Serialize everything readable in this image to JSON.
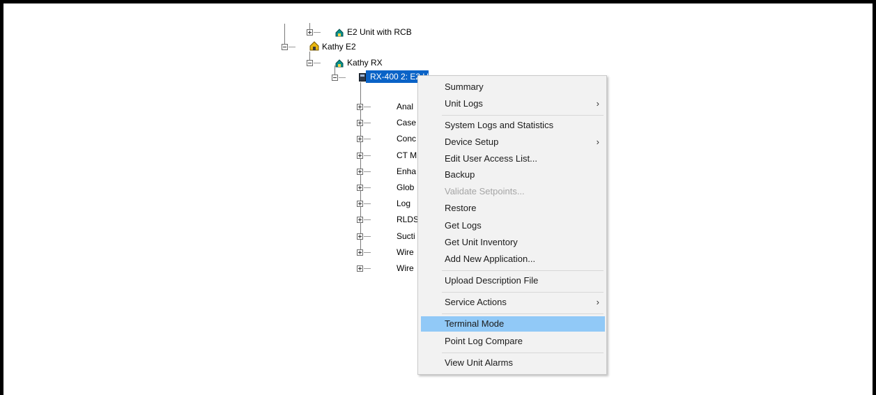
{
  "tree": {
    "nodes": [
      {
        "label": "E2 Unit with RCB",
        "icon": "unit-icon"
      },
      {
        "label": "Kathy E2",
        "icon": "site-icon"
      },
      {
        "label": "Kathy RX",
        "icon": "unit-icon"
      },
      {
        "label": "RX-400 2: E2 Unit02",
        "icon": "controller-icon",
        "selected": true
      }
    ],
    "children": [
      "Anal",
      "Case",
      "Conc",
      "CT M",
      "Enha",
      "Glob",
      "Log",
      "RLDS",
      "Sucti",
      "Wire",
      "Wire"
    ]
  },
  "context_menu": {
    "items": [
      {
        "label": "Summary"
      },
      {
        "label": "Unit Logs",
        "submenu": true
      },
      {
        "label": "System Logs and Statistics"
      },
      {
        "label": "Device Setup",
        "submenu": true
      },
      {
        "label": "Edit User Access List..."
      },
      {
        "label": "Backup"
      },
      {
        "label": "Validate Setpoints...",
        "disabled": true
      },
      {
        "label": "Restore"
      },
      {
        "label": "Get Logs"
      },
      {
        "label": "Get Unit Inventory"
      },
      {
        "label": "Add New Application..."
      },
      {
        "label": "Upload Description File"
      },
      {
        "label": "Service Actions",
        "submenu": true
      },
      {
        "label": "Terminal Mode",
        "highlighted": true
      },
      {
        "label": "Point Log Compare"
      },
      {
        "label": "View Unit Alarms"
      }
    ],
    "submenu_arrow": "›"
  },
  "colors": {
    "selection": "#0a63c7",
    "menu_highlight": "#91c9f7",
    "menu_background": "#f2f2f2",
    "disabled_text": "#a5a5a5"
  }
}
